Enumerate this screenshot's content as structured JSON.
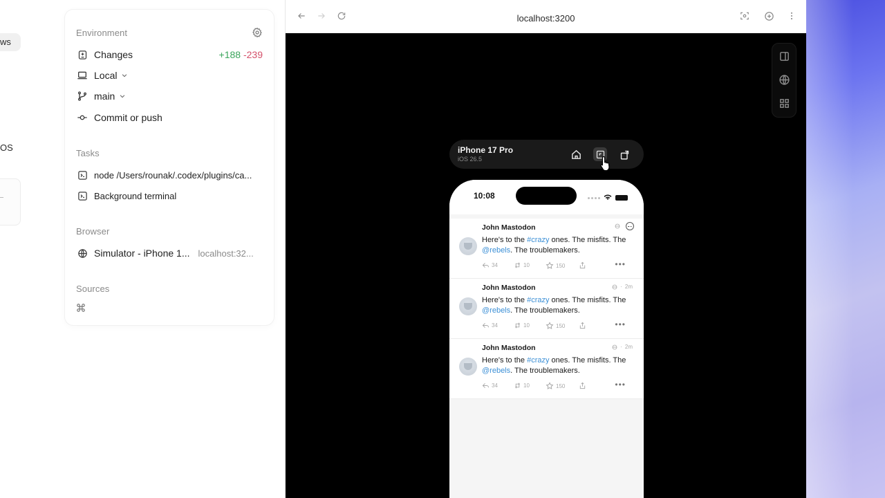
{
  "left_fragments": {
    "news_text": "ws",
    "os_text": "OS"
  },
  "environment": {
    "title": "Environment",
    "changes": {
      "label": "Changes",
      "added": "+188",
      "removed": "-239"
    },
    "local": {
      "label": "Local"
    },
    "branch": {
      "label": "main"
    },
    "commit": {
      "label": "Commit or push"
    }
  },
  "tasks": {
    "title": "Tasks",
    "items": [
      {
        "label": "node /Users/rounak/.codex/plugins/ca...",
        "icon": "terminal-icon"
      },
      {
        "label": "Background terminal",
        "icon": "terminal-icon"
      }
    ]
  },
  "browser_section": {
    "title": "Browser",
    "item": {
      "label": "Simulator - iPhone 1...",
      "url": "localhost:32..."
    }
  },
  "sources": {
    "title": "Sources",
    "icon": "command-icon"
  },
  "browser": {
    "url": "localhost:3200"
  },
  "simulator": {
    "device": "iPhone 17 Pro",
    "os": "iOS 26.5",
    "status_time": "10:08",
    "posts": [
      {
        "author": "John Mastodon",
        "meta": "",
        "text_prefix": "Here's to the ",
        "hashtag": "#crazy",
        "text_mid": " ones. The misfits. The ",
        "mention": "@rebels",
        "text_suffix": ". The troublemakers.",
        "replies": "34",
        "boosts": "10",
        "favs": "150"
      },
      {
        "author": "John Mastodon",
        "meta": "2m",
        "text_prefix": "Here's to the ",
        "hashtag": "#crazy",
        "text_mid": " ones. The misfits. The ",
        "mention": "@rebels",
        "text_suffix": ". The troublemakers.",
        "replies": "34",
        "boosts": "10",
        "favs": "150"
      },
      {
        "author": "John Mastodon",
        "meta": "2m",
        "text_prefix": "Here's to the ",
        "hashtag": "#crazy",
        "text_mid": " ones. The misfits. The ",
        "mention": "@rebels",
        "text_suffix": ". The troublemakers.",
        "replies": "34",
        "boosts": "10",
        "favs": "150"
      }
    ]
  },
  "colors": {
    "added": "#3aa55b",
    "removed": "#d4506a",
    "link": "#3b8fd6",
    "viewport": "#000000"
  }
}
